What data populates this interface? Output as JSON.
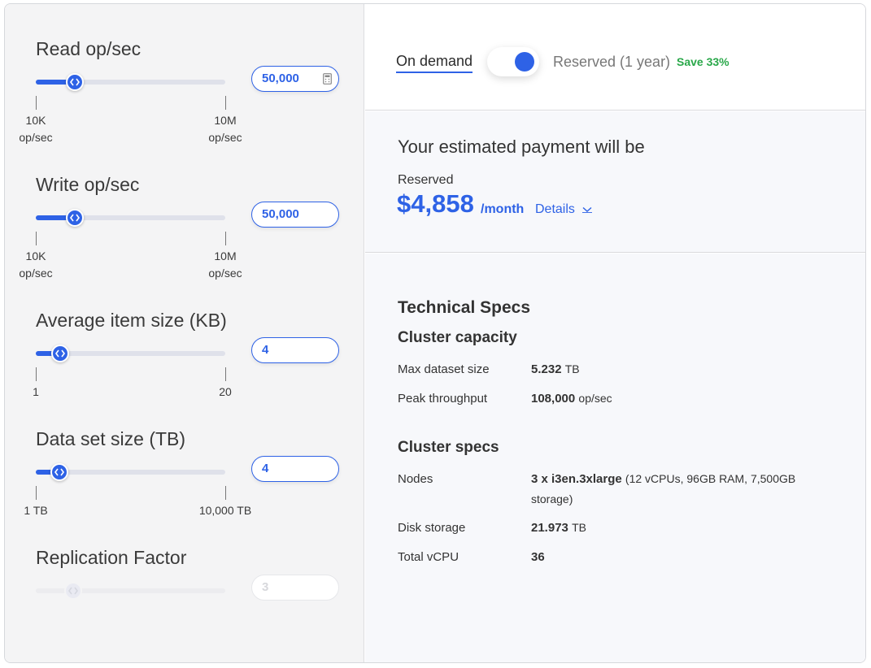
{
  "sliders": [
    {
      "title": "Read op/sec",
      "min_label": [
        "10K",
        "op/sec"
      ],
      "max_label": [
        "10M",
        "op/sec"
      ],
      "value": "50,000",
      "knob_position": 0.207,
      "has_calc_icon": true
    },
    {
      "title": "Write op/sec",
      "min_label": [
        "10K",
        "op/sec"
      ],
      "max_label": [
        "10M",
        "op/sec"
      ],
      "value": "50,000",
      "knob_position": 0.207
    },
    {
      "title": "Average item size (KB)",
      "min_label": [
        "1"
      ],
      "max_label": [
        "20"
      ],
      "value": "4",
      "knob_position": 0.129
    },
    {
      "title": "Data set size (TB)",
      "min_label": [
        "1 TB"
      ],
      "max_label": [
        "10,000 TB"
      ],
      "value": "4",
      "knob_position": 0.124
    },
    {
      "title": "Replication Factor",
      "value": "3",
      "knob_position": 0.197,
      "disabled": true
    }
  ],
  "pricing_toggle": {
    "on_demand_label": "On demand",
    "reserved_label": "Reserved (1 year)",
    "save_badge": "Save 33%",
    "selected": "reserved"
  },
  "payment": {
    "title": "Your estimated payment will be",
    "type": "Reserved",
    "price": "$4,858",
    "unit": "/month",
    "details_label": "Details"
  },
  "specs": {
    "title": "Technical Specs",
    "capacity_title": "Cluster capacity",
    "capacity": [
      {
        "key": "Max dataset size",
        "value": "5.232",
        "unit": "TB"
      },
      {
        "key": "Peak throughput",
        "value": "108,000",
        "unit": "op/sec"
      }
    ],
    "cluster_title": "Cluster specs",
    "cluster": [
      {
        "key": "Nodes",
        "value": "3 x i3en.3xlarge",
        "unit": "(12 vCPUs, 96GB RAM, 7,500GB storage)"
      },
      {
        "key": "Disk storage",
        "value": "21.973",
        "unit": "TB"
      },
      {
        "key": "Total vCPU",
        "value": "36",
        "unit": ""
      }
    ]
  },
  "colors": {
    "accent": "#2e62e6",
    "save_green": "#2aa84a",
    "panel_bg": "#f4f4f5"
  }
}
